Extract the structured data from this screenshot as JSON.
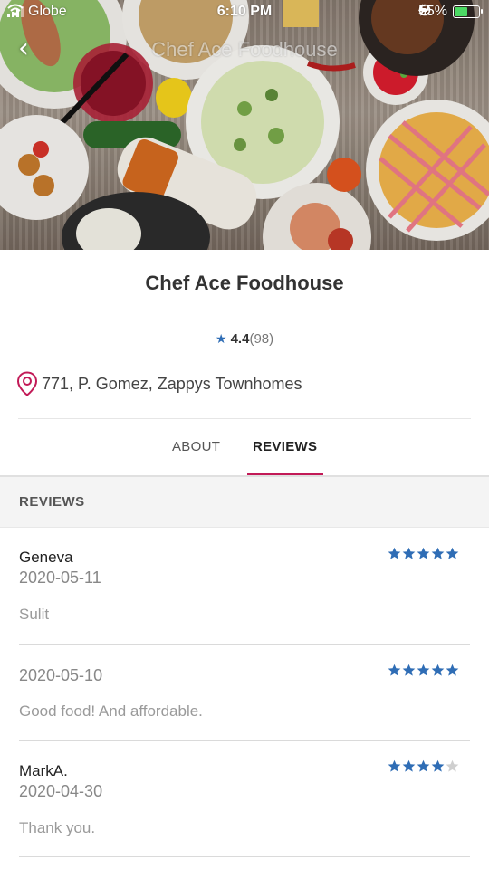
{
  "status_bar": {
    "carrier": "Globe",
    "time": "6:10 PM",
    "battery_percent": "55%",
    "battery_level": 0.55,
    "battery_color": "#4cd964"
  },
  "hero": {
    "title": "Chef Ace Foodhouse",
    "back_icon": "chevron-left-icon"
  },
  "restaurant": {
    "name": "Chef Ace Foodhouse",
    "rating": "4.4",
    "rating_count": "(98)",
    "address": "771, P. Gomez, Zappys Townhomes"
  },
  "tabs": {
    "about": "ABOUT",
    "reviews": "REVIEWS",
    "active": "reviews",
    "accent_color": "#c21a57"
  },
  "reviews_section": {
    "header": "REVIEWS",
    "star_color": "#2f6db5",
    "items": [
      {
        "name": "Geneva",
        "date": "2020-05-11",
        "comment": "Sulit",
        "stars": 5
      },
      {
        "name": "",
        "date": "2020-05-10",
        "comment": "Good food! And affordable.",
        "stars": 5
      },
      {
        "name": "MarkA.",
        "date": "2020-04-30",
        "comment": "Thank you.",
        "stars": 4
      }
    ]
  }
}
